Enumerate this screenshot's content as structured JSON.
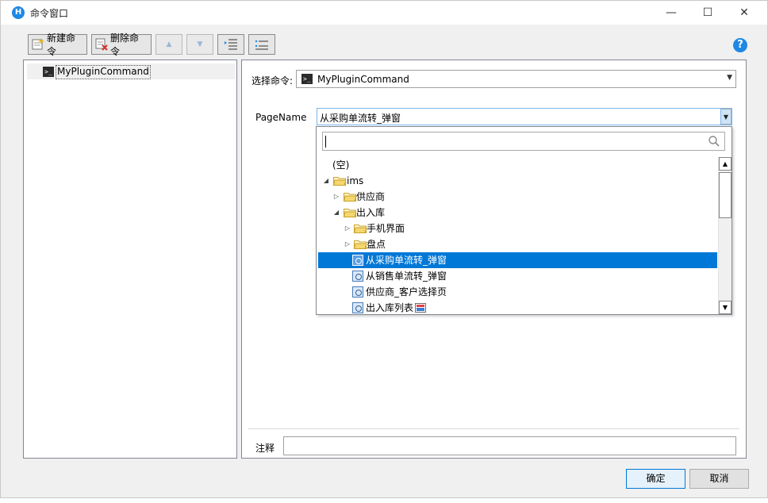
{
  "window": {
    "title": "命令窗口",
    "controls": {
      "minimize": "—",
      "maximize": "☐",
      "close": "✕"
    }
  },
  "toolbar": {
    "new_command_label": "新建命令",
    "delete_command_label": "删除命令",
    "move_up": "▲",
    "move_down": "▼"
  },
  "help": "?",
  "command_tree": {
    "items": [
      {
        "label": "MyPluginCommand"
      }
    ]
  },
  "editor": {
    "select_command_label": "选择命令:",
    "selected_command": "MyPluginCommand",
    "page_name_label": "PageName",
    "page_name_value": "从采购单流转_弹窗",
    "note_label": "注释",
    "note_value": ""
  },
  "dropdown": {
    "search_value": "",
    "items": [
      {
        "label": "(空)",
        "type": "empty"
      },
      {
        "label": "ims",
        "type": "folder",
        "expanded": true
      },
      {
        "label": "供应商",
        "type": "folder",
        "expanded": false
      },
      {
        "label": "出入库",
        "type": "folder",
        "expanded": true
      },
      {
        "label": "手机界面",
        "type": "folder",
        "expanded": false
      },
      {
        "label": "盘点",
        "type": "folder",
        "expanded": false
      },
      {
        "label": "从采购单流转_弹窗",
        "type": "page",
        "selected": true
      },
      {
        "label": "从销售单流转_弹窗",
        "type": "page"
      },
      {
        "label": "供应商_客户选择页",
        "type": "page"
      },
      {
        "label": "出入库列表",
        "type": "page"
      }
    ]
  },
  "footer": {
    "ok_label": "确定",
    "cancel_label": "取消"
  },
  "colors": {
    "selection": "#0078d7",
    "accent": "#1e88e5",
    "folder": "#f5d76e"
  }
}
